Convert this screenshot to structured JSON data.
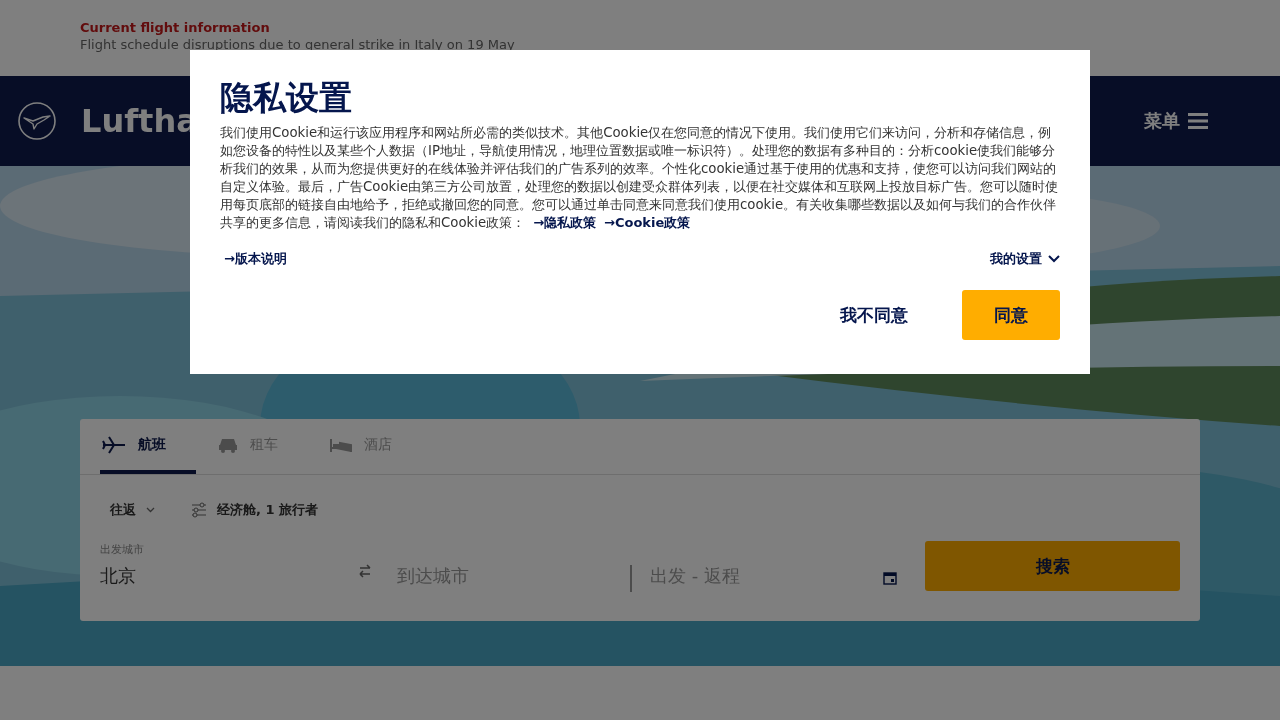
{
  "notice": {
    "title": "Current flight information",
    "text": "Flight schedule disruptions due to general strike in Italy on 19 May"
  },
  "header": {
    "logo_text": "Luftha",
    "menu_label": "菜单"
  },
  "booking": {
    "tabs": [
      {
        "label": "航班",
        "kind": "plane",
        "selected": true
      },
      {
        "label": "租车",
        "kind": "car",
        "selected": false
      },
      {
        "label": "酒店",
        "kind": "bed",
        "selected": false
      }
    ],
    "trip_type": "往返",
    "passengers": "经济舱, 1 旅行者",
    "origin": {
      "label": "出发城市",
      "value": "北京"
    },
    "destination": {
      "placeholder": "到达城市"
    },
    "dates": {
      "placeholder": "出发 - 返程"
    },
    "search_button": "搜索"
  },
  "privacy_dialog": {
    "title": "隐私设置",
    "body": "我们使用Cookie和运行该应用程序和网站所必需的类似技术。其他Cookie仅在您同意的情况下使用。我们使用它们来访问，分析和存储信息，例如您设备的特性以及某些个人数据（IP地址，导航使用情况，地理位置数据或唯一标识符）。处理您的数据有多种目的：分析cookie使我们能够分析我们的效果，从而为您提供更好的在线体验并评估我们的广告系列的效率。个性化cookie通过基于使用的优惠和支持，使您可以访问我们网站的自定义体验。最后，广告Cookie由第三方公司放置，处理您的数据以创建受众群体列表，以便在社交媒体和互联网上投放目标广告。您可以随时使用每页底部的链接自由地给予，拒绝或撤回您的同意。您可以通过单击同意来同意我们使用cookie。有关收集哪些数据以及如何与我们的合作伙伴共享的更多信息，请阅读我们的隐私和Cookie政策：",
    "links": [
      "→隐私政策",
      "→Cookie政策"
    ],
    "release_notes_link": "→版本说明",
    "settings_toggle": {
      "label": "我的设置",
      "expanded": false
    },
    "buttons": [
      {
        "label": "我不同意",
        "kind": "secondary"
      },
      {
        "label": "同意",
        "kind": "primary"
      }
    ]
  }
}
